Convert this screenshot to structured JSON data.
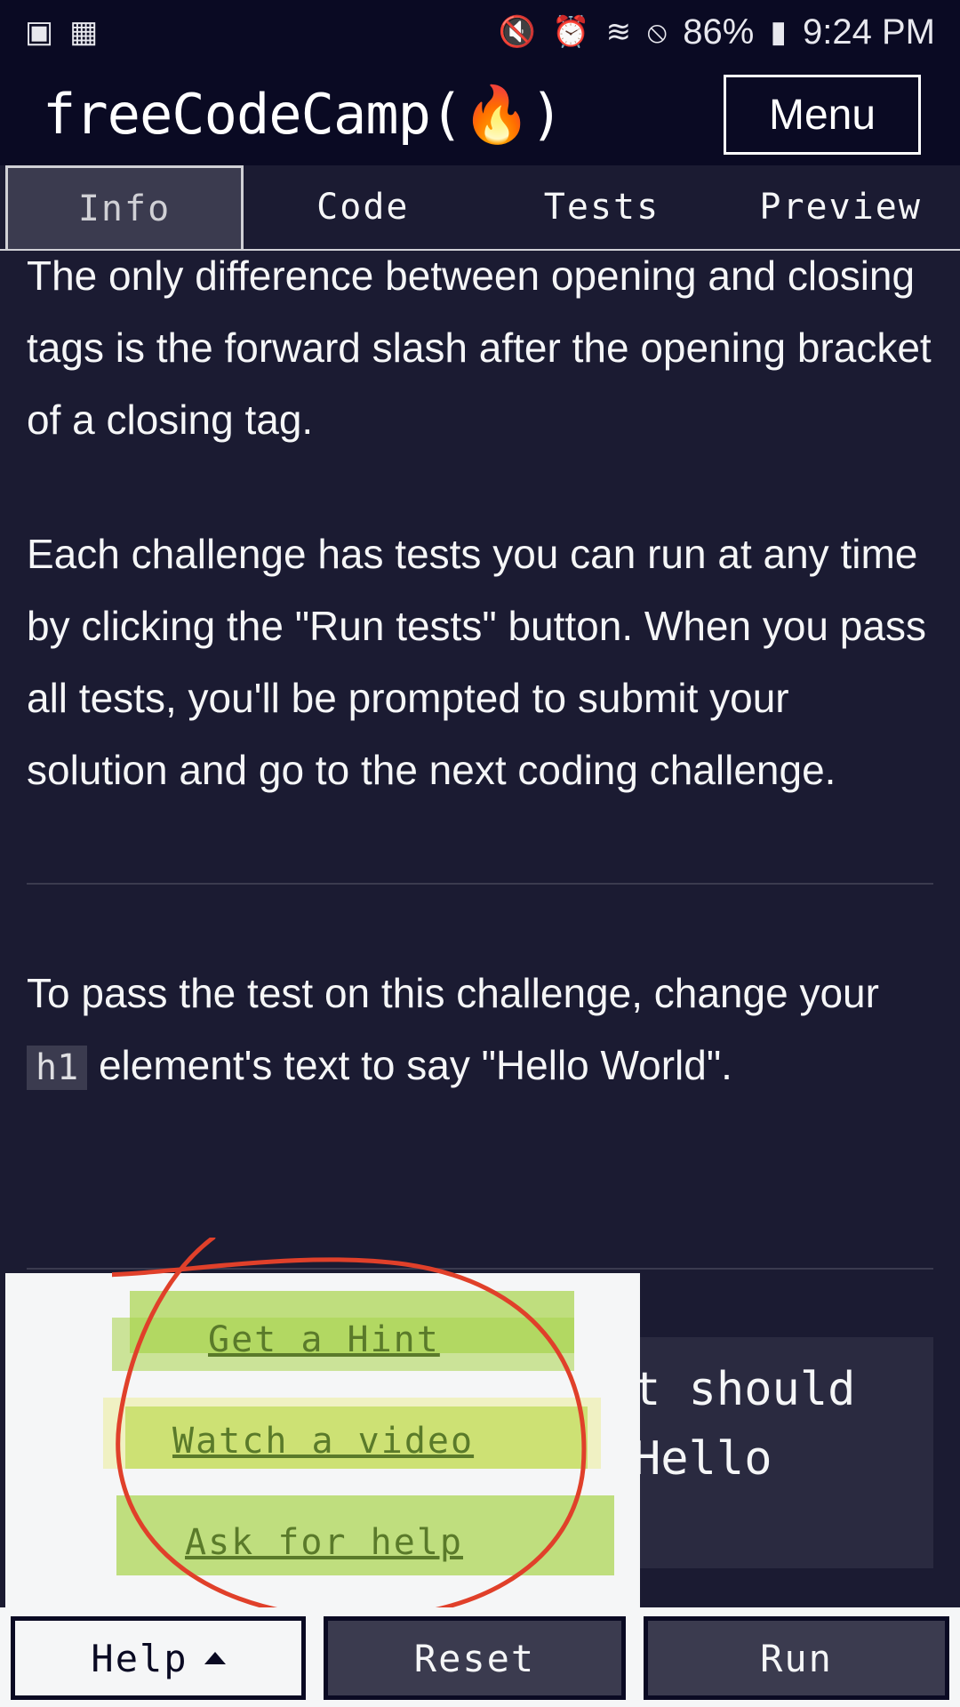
{
  "status_bar": {
    "battery": "86%",
    "time": "9:24 PM",
    "icons_left": [
      "book-icon",
      "qr-icon"
    ],
    "icons_right": [
      "mute-icon",
      "alarm-icon",
      "wifi-icon",
      "block-icon",
      "battery-icon"
    ]
  },
  "header": {
    "logo": "freeCodeCamp(🔥)",
    "menu_label": "Menu"
  },
  "tabs": [
    {
      "label": "Info",
      "active": true
    },
    {
      "label": "Code",
      "active": false
    },
    {
      "label": "Tests",
      "active": false
    },
    {
      "label": "Preview",
      "active": false
    }
  ],
  "content": {
    "para1": "The only difference between opening and closing tags is the forward slash after the opening bracket of a closing tag.",
    "para2": "Each challenge has tests you can run at any time by clicking the \"Run tests\" button. When you pass all tests, you'll be prompted to submit your solution and go to the next coding challenge.",
    "para3_before": "To pass the test on this challenge, change your",
    "para3_code": "h1",
    "para3_after": "element's text to say \"Hello World\".",
    "code_partial_line1": "t should",
    "code_partial_line2": "Hello"
  },
  "help_menu": {
    "hint": "Get a Hint",
    "video": "Watch a video",
    "ask": "Ask for help"
  },
  "bottom": {
    "help": "Help",
    "reset": "Reset",
    "run": "Run"
  },
  "colors": {
    "bg": "#1b1b32",
    "header": "#0a0a23",
    "highlight": "#a8d44a",
    "annotation": "#e0402a"
  }
}
